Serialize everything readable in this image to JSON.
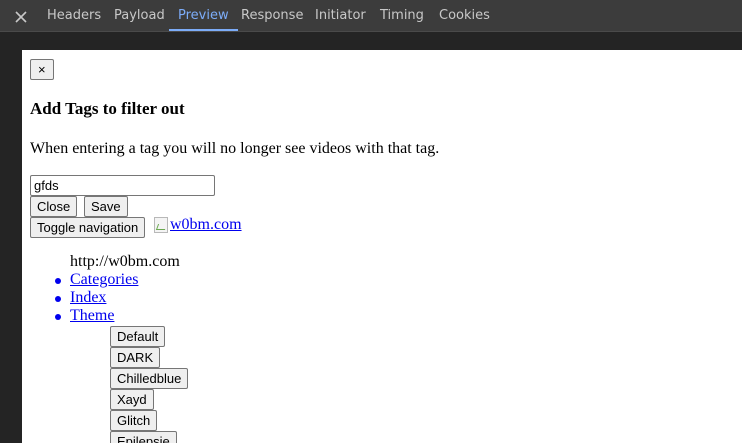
{
  "devtools": {
    "tabs": [
      {
        "label": "Headers"
      },
      {
        "label": "Payload"
      },
      {
        "label": "Preview"
      },
      {
        "label": "Response"
      },
      {
        "label": "Initiator"
      },
      {
        "label": "Timing"
      },
      {
        "label": "Cookies"
      }
    ],
    "active_tab": "Preview",
    "accent_color": "#7cacf8"
  },
  "preview": {
    "dismiss_label": "×",
    "heading": "Add Tags to filter out",
    "description": "When entering a tag you will no longer see videos with that tag.",
    "tag_input_value": "gfds",
    "close_label": "Close",
    "save_label": "Save",
    "toggle_nav_label": "Toggle navigation",
    "logo_alt": "w0bm.com",
    "brand_text": "http://w0bm.com",
    "nav_links": [
      {
        "label": "Categories"
      },
      {
        "label": "Index"
      },
      {
        "label": "Theme"
      }
    ],
    "themes": [
      {
        "label": "Default"
      },
      {
        "label": "DARK"
      },
      {
        "label": "Chilledblue"
      },
      {
        "label": "Xayd"
      },
      {
        "label": "Glitch"
      },
      {
        "label": "Epilepsie"
      }
    ],
    "link_color": "#0000ee"
  }
}
